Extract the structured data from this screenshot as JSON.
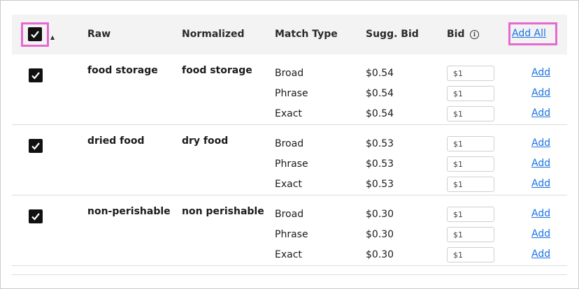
{
  "header": {
    "raw": "Raw",
    "normalized": "Normalized",
    "match_type": "Match Type",
    "sugg_bid": "Sugg. Bid",
    "bid": "Bid",
    "add_all": "Add All"
  },
  "rows": [
    {
      "raw": "food storage",
      "normalized": "food storage",
      "lines": [
        {
          "match": "Broad",
          "sugg": "$0.54",
          "bid": "$1",
          "add": "Add"
        },
        {
          "match": "Phrase",
          "sugg": "$0.54",
          "bid": "$1",
          "add": "Add"
        },
        {
          "match": "Exact",
          "sugg": "$0.54",
          "bid": "$1",
          "add": "Add"
        }
      ]
    },
    {
      "raw": "dried food",
      "normalized": "dry food",
      "lines": [
        {
          "match": "Broad",
          "sugg": "$0.53",
          "bid": "$1",
          "add": "Add"
        },
        {
          "match": "Phrase",
          "sugg": "$0.53",
          "bid": "$1",
          "add": "Add"
        },
        {
          "match": "Exact",
          "sugg": "$0.53",
          "bid": "$1",
          "add": "Add"
        }
      ]
    },
    {
      "raw": "non-perishable",
      "normalized": "non perishable",
      "lines": [
        {
          "match": "Broad",
          "sugg": "$0.30",
          "bid": "$1",
          "add": "Add"
        },
        {
          "match": "Phrase",
          "sugg": "$0.30",
          "bid": "$1",
          "add": "Add"
        },
        {
          "match": "Exact",
          "sugg": "$0.30",
          "bid": "$1",
          "add": "Add"
        }
      ]
    }
  ],
  "colors": {
    "link": "#1a73e8",
    "highlight": "#e56ad0",
    "checkbox": "#111111"
  },
  "icons": [
    "checkmark-icon",
    "sort-caret-icon",
    "info-icon"
  ]
}
